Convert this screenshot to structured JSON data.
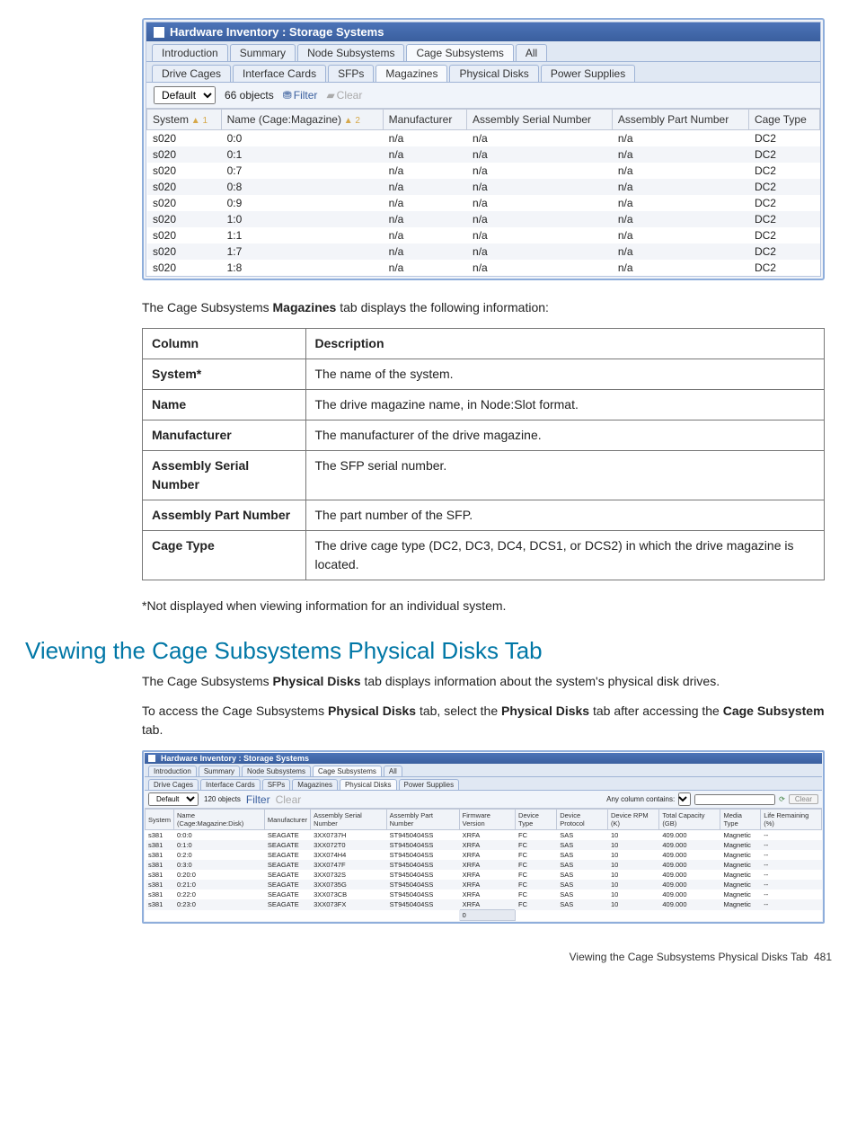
{
  "screenshot1": {
    "title": "Hardware Inventory : Storage Systems",
    "tabs1": [
      "Introduction",
      "Summary",
      "Node Subsystems",
      "Cage Subsystems",
      "All"
    ],
    "tabs1_active": 3,
    "tabs2": [
      "Drive Cages",
      "Interface Cards",
      "SFPs",
      "Magazines",
      "Physical Disks",
      "Power Supplies"
    ],
    "tabs2_active": 3,
    "filter": {
      "select_label": "Default",
      "count": "66 objects",
      "filter_label": "Filter",
      "clear_label": "Clear"
    },
    "columns": [
      {
        "label": "System",
        "sort": "1"
      },
      {
        "label": "Name (Cage:Magazine)",
        "sort": "2"
      },
      {
        "label": "Manufacturer"
      },
      {
        "label": "Assembly Serial Number"
      },
      {
        "label": "Assembly Part Number"
      },
      {
        "label": "Cage Type"
      }
    ],
    "rows": [
      {
        "system": "s020",
        "name": "0:0",
        "mfr": "n/a",
        "asn": "n/a",
        "apn": "n/a",
        "cage": "DC2"
      },
      {
        "system": "s020",
        "name": "0:1",
        "mfr": "n/a",
        "asn": "n/a",
        "apn": "n/a",
        "cage": "DC2"
      },
      {
        "system": "s020",
        "name": "0:7",
        "mfr": "n/a",
        "asn": "n/a",
        "apn": "n/a",
        "cage": "DC2"
      },
      {
        "system": "s020",
        "name": "0:8",
        "mfr": "n/a",
        "asn": "n/a",
        "apn": "n/a",
        "cage": "DC2"
      },
      {
        "system": "s020",
        "name": "0:9",
        "mfr": "n/a",
        "asn": "n/a",
        "apn": "n/a",
        "cage": "DC2"
      },
      {
        "system": "s020",
        "name": "1:0",
        "mfr": "n/a",
        "asn": "n/a",
        "apn": "n/a",
        "cage": "DC2"
      },
      {
        "system": "s020",
        "name": "1:1",
        "mfr": "n/a",
        "asn": "n/a",
        "apn": "n/a",
        "cage": "DC2"
      },
      {
        "system": "s020",
        "name": "1:7",
        "mfr": "n/a",
        "asn": "n/a",
        "apn": "n/a",
        "cage": "DC2"
      },
      {
        "system": "s020",
        "name": "1:8",
        "mfr": "n/a",
        "asn": "n/a",
        "apn": "n/a",
        "cage": "DC2"
      }
    ]
  },
  "intro_para": "The Cage Subsystems Magazines tab displays the following information:",
  "doc_table": {
    "head": [
      "Column",
      "Description"
    ],
    "rows": [
      [
        "System*",
        "The name of the system."
      ],
      [
        "Name",
        "The drive magazine name, in Node:Slot format."
      ],
      [
        "Manufacturer",
        "The manufacturer of the drive magazine."
      ],
      [
        "Assembly Serial Number",
        "The SFP serial number."
      ],
      [
        "Assembly Part Number",
        "The part number of the SFP."
      ],
      [
        "Cage Type",
        "The drive cage type (DC2, DC3, DC4, DCS1, or DCS2) in which the drive magazine is located."
      ]
    ]
  },
  "footnote": "*Not displayed when viewing information for an individual system.",
  "section_heading": "Viewing the Cage Subsystems Physical Disks Tab",
  "section_para1a": "The Cage Subsystems ",
  "section_para1b": "Physical Disks",
  "section_para1c": " tab displays information about the system's physical disk drives.",
  "section_para2a": "To access the Cage Subsystems ",
  "section_para2b": "Physical Disks",
  "section_para2c": " tab, select the ",
  "section_para2d": "Physical Disks",
  "section_para2e": " tab after accessing the ",
  "section_para2f": "Cage Subsystem",
  "section_para2g": " tab.",
  "screenshot2": {
    "title": "Hardware Inventory : Storage Systems",
    "tabs1": [
      "Introduction",
      "Summary",
      "Node Subsystems",
      "Cage Subsystems",
      "All"
    ],
    "tabs1_active": 3,
    "tabs2": [
      "Drive Cages",
      "Interface Cards",
      "SFPs",
      "Magazines",
      "Physical Disks",
      "Power Supplies"
    ],
    "tabs2_active": 4,
    "filter": {
      "select_label": "Default",
      "count": "120 objects",
      "filter_label": "Filter",
      "clear_label": "Clear",
      "right_label": "Any column contains:",
      "right_clear": "Clear"
    },
    "columns": [
      "System",
      "Name (Cage:Magazine:Disk)",
      "Manufacturer",
      "Assembly Serial Number",
      "Assembly Part Number",
      "Firmware Version",
      "Device Type",
      "Device Protocol",
      "Device RPM (K)",
      "Total Capacity (GB)",
      "Media Type",
      "Life Remaining (%)"
    ],
    "rows": [
      {
        "c": [
          "s381",
          "0:0:0",
          "SEAGATE",
          "3XX0737H",
          "ST9450404SS",
          "XRFA",
          "FC",
          "SAS",
          "10",
          "409.000",
          "Magnetic",
          "--"
        ]
      },
      {
        "c": [
          "s381",
          "0:1:0",
          "SEAGATE",
          "3XX072T0",
          "ST9450404SS",
          "XRFA",
          "FC",
          "SAS",
          "10",
          "409.000",
          "Magnetic",
          "--"
        ]
      },
      {
        "c": [
          "s381",
          "0:2:0",
          "SEAGATE",
          "3XX074H4",
          "ST9450404SS",
          "XRFA",
          "FC",
          "SAS",
          "10",
          "409.000",
          "Magnetic",
          "--"
        ]
      },
      {
        "c": [
          "s381",
          "0:3:0",
          "SEAGATE",
          "3XX0747F",
          "ST9450404SS",
          "XRFA",
          "FC",
          "SAS",
          "10",
          "409.000",
          "Magnetic",
          "--"
        ]
      },
      {
        "c": [
          "s381",
          "0:20:0",
          "SEAGATE",
          "3XX0732S",
          "ST9450404SS",
          "XRFA",
          "FC",
          "SAS",
          "10",
          "409.000",
          "Magnetic",
          "--"
        ]
      },
      {
        "c": [
          "s381",
          "0:21:0",
          "SEAGATE",
          "3XX0735G",
          "ST9450404SS",
          "XRFA",
          "FC",
          "SAS",
          "10",
          "409.000",
          "Magnetic",
          "--"
        ]
      },
      {
        "c": [
          "s381",
          "0:22:0",
          "SEAGATE",
          "3XX073CB",
          "ST9450404SS",
          "XRFA",
          "FC",
          "SAS",
          "10",
          "409.000",
          "Magnetic",
          "--"
        ]
      },
      {
        "c": [
          "s381",
          "0:23:0",
          "SEAGATE",
          "3XX073FX",
          "ST9450404SS",
          "XRFA",
          "FC",
          "SAS",
          "10",
          "409.000",
          "Magnetic",
          "--"
        ]
      }
    ],
    "footer_count": "0"
  },
  "page_footer": {
    "title": "Viewing the Cage Subsystems Physical Disks Tab",
    "num": "481"
  }
}
